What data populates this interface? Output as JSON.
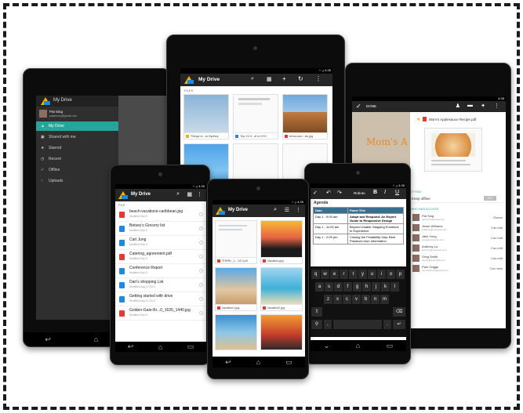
{
  "tablet_left": {
    "account_name": "Pat Sing",
    "account_email": "patsonnny@gmail.com",
    "nav_items": [
      "My Drive",
      "Shared with me",
      "Starred",
      "Recent",
      "Offline",
      "Uploads"
    ]
  },
  "tablet_center": {
    "status_time": "4:35",
    "title": "My Drive",
    "section": "FILES",
    "files": [
      "Things to...to Sydney",
      "Trip 10-9...st in NYC",
      "trivia-card...ds.jpg",
      "",
      "",
      ""
    ]
  },
  "tablet_right": {
    "status_time": "4:35",
    "done_label": "DONE",
    "doc_title": "Mom's Applesauce Recipe.pdf",
    "preview_title": "Mom's A",
    "settings_label": "ETTING",
    "offline_label": "Keep offline",
    "offline_state": "OFF",
    "access_label": "WHO HAS ACCESS",
    "people": [
      {
        "name": "Pat Sing",
        "email": "patsonny@gmail.com",
        "role": "Owner"
      },
      {
        "name": "Jesse Williams",
        "email": "jwilliams@example.com",
        "role": "Can edit"
      },
      {
        "name": "Jake Yung",
        "email": "jyung@example.com",
        "role": "Can edit"
      },
      {
        "name": "Anthony Lu",
        "email": "anthony@example.com",
        "role": "Can edit"
      },
      {
        "name": "Greg Smith",
        "email": "gsmith@example.com",
        "role": "Can edit"
      },
      {
        "name": "Pam Griggs",
        "email": "pamecolemo@gmail.com",
        "role": "Can view"
      }
    ]
  },
  "phone_left": {
    "status_time": "4:35",
    "title": "My Drive",
    "section": "FILE",
    "files": [
      {
        "name": "beach-vacations-caribbean.jpg",
        "meta": "Modified Sep 8",
        "color": "#e53935"
      },
      {
        "name": "Betsey's Grocery list",
        "meta": "Modified Sep 8",
        "color": "#1e88e5"
      },
      {
        "name": "Carl Jung",
        "meta": "Modified Sep 8",
        "color": "#1e88e5"
      },
      {
        "name": "Catering_agreement.pdf",
        "meta": "Modified Sep 8",
        "color": "#e53935"
      },
      {
        "name": "Conference Report",
        "meta": "Modified Sep 8",
        "color": "#1e88e5"
      },
      {
        "name": "Dan's shopping List",
        "meta": "Modified Aug 21 2013",
        "color": "#1e88e5"
      },
      {
        "name": "Getting started with drive",
        "meta": "Modified Aug 21 2013",
        "color": "#1e88e5"
      },
      {
        "name": "Golden-Gate-Br...0_1635_1440.jpg",
        "meta": "Modified Sep 8",
        "color": "#e53935"
      }
    ]
  },
  "phone_center": {
    "status_time": "4:35",
    "title": "My Drive",
    "files": [
      "THRRL_1...147.pdf",
      "Vacation.jpg",
      "vacation1.jpg",
      "vacation2.jpg"
    ]
  },
  "phone_right": {
    "status_time": "4:35",
    "doc_title": "Agenda",
    "font_label": "Roboto",
    "table_headers": [
      "Date",
      "Panel Title"
    ],
    "table_rows": [
      {
        "date": "Day 1 - 9:00 am",
        "title": "Adapt and Respond: An Expert Guide to Responsive Design"
      },
      {
        "date": "Day 1 - 11:00 am",
        "title": "Beyond Usable: Mapping Emotions to Experience"
      },
      {
        "date": "Day 1 - 2:00 pm",
        "title": "Closing the Findability Gap: Best Practices from Information"
      }
    ],
    "keyboard_rows": [
      [
        "q",
        "w",
        "e",
        "r",
        "t",
        "y",
        "u",
        "i",
        "o",
        "p"
      ],
      [
        "a",
        "s",
        "d",
        "f",
        "g",
        "h",
        "j",
        "k",
        "l"
      ],
      [
        "z",
        "x",
        "c",
        "v",
        "b",
        "n",
        "m"
      ]
    ]
  },
  "colors": {
    "drive_yellow": "#f4b400",
    "drive_blue": "#1e88e5",
    "drive_green": "#0f9d58",
    "teal": "#26a69a",
    "orange": "#f57c00"
  }
}
